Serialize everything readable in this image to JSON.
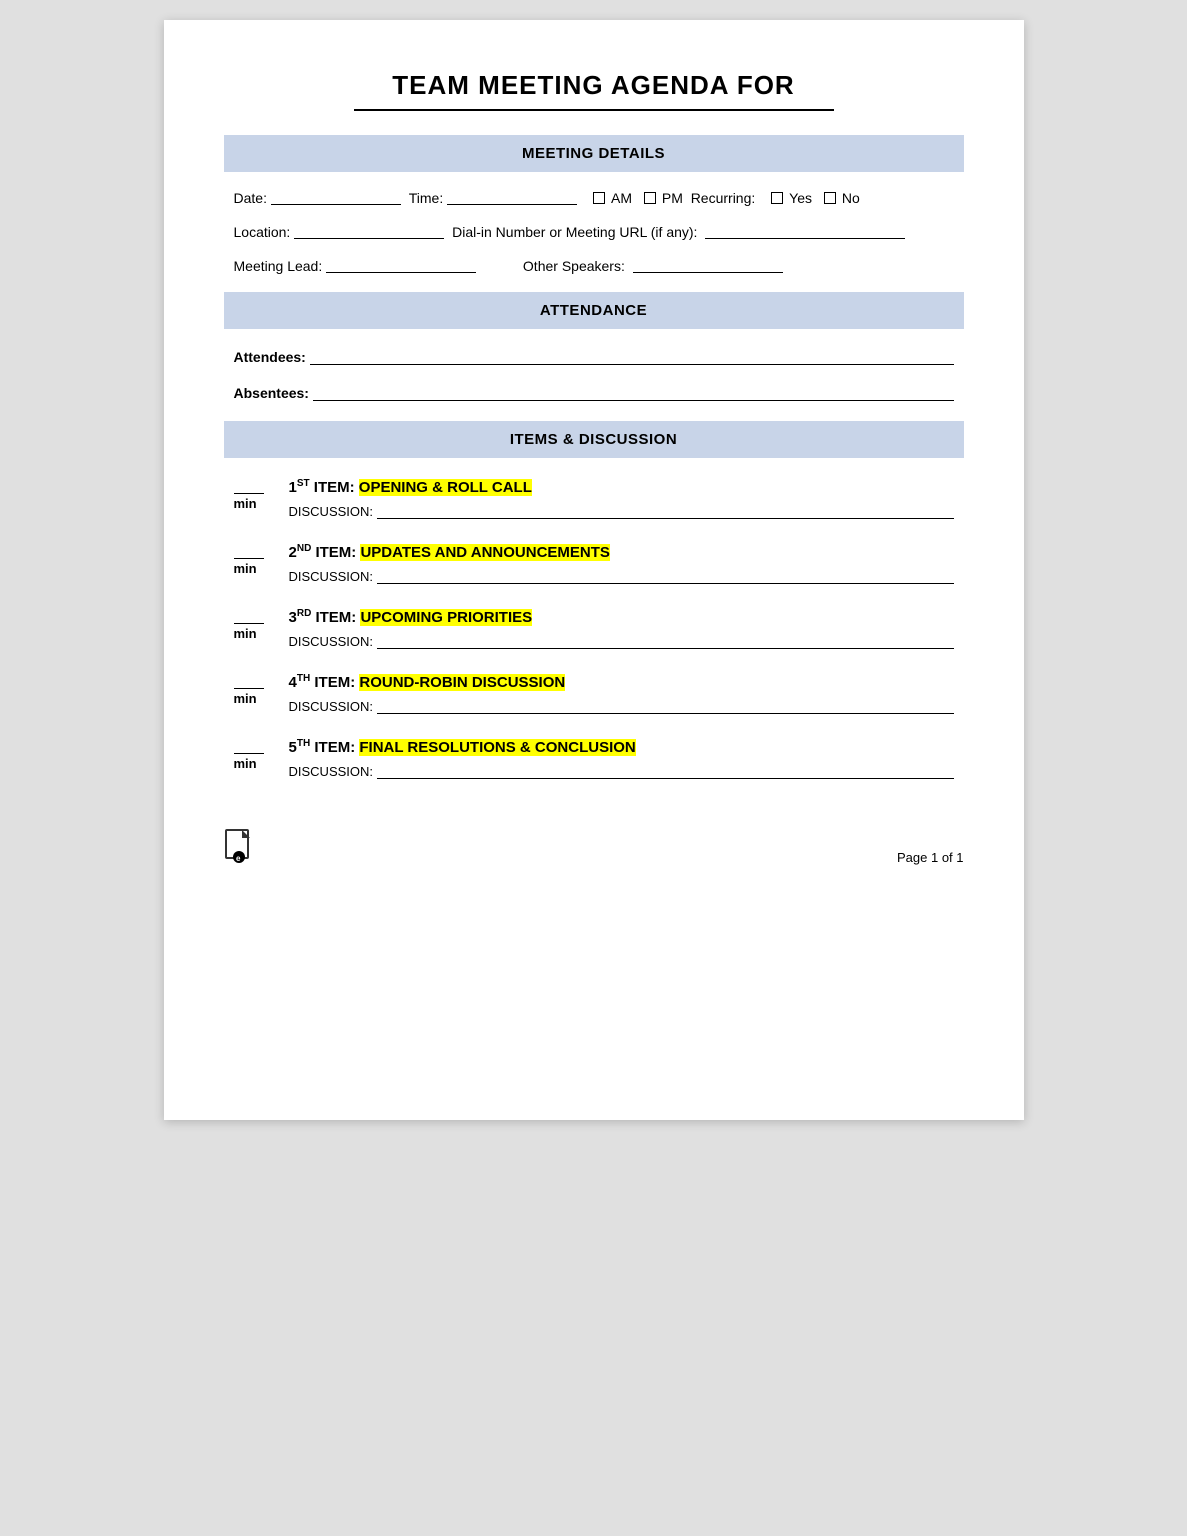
{
  "title": "TEAM MEETING AGENDA FOR",
  "sections": {
    "meeting_details": {
      "header": "MEETING DETAILS",
      "fields": {
        "date_label": "Date:",
        "time_label": "Time:",
        "am_label": "AM",
        "pm_label": "PM",
        "recurring_label": "Recurring:",
        "yes_label": "Yes",
        "no_label": "No",
        "location_label": "Location:",
        "dialin_label": "Dial-in Number or Meeting URL (if any):",
        "meeting_lead_label": "Meeting Lead:",
        "other_speakers_label": "Other Speakers:"
      }
    },
    "attendance": {
      "header": "ATTENDANCE",
      "attendees_label": "Attendees:",
      "absentees_label": "Absentees:"
    },
    "items_discussion": {
      "header": "ITEMS & DISCUSSION",
      "items": [
        {
          "number": "1",
          "ordinal": "ST",
          "title_prefix": "ITEM: ",
          "title_highlight": "OPENING & ROLL CALL",
          "discussion_label": "DISCUSSION:"
        },
        {
          "number": "2",
          "ordinal": "ND",
          "title_prefix": "ITEM: ",
          "title_highlight": "UPDATES AND ANNOUNCEMENTS",
          "discussion_label": "DISCUSSION:"
        },
        {
          "number": "3",
          "ordinal": "RD",
          "title_prefix": "ITEM: ",
          "title_highlight": "UPCOMING PRIORITIES",
          "discussion_label": "DISCUSSION:"
        },
        {
          "number": "4",
          "ordinal": "TH",
          "title_prefix": "ITEM: ",
          "title_highlight": "ROUND-ROBIN DISCUSSION",
          "discussion_label": "DISCUSSION:"
        },
        {
          "number": "5",
          "ordinal": "TH",
          "title_prefix": "ITEM: ",
          "title_highlight": "FINAL RESOLUTIONS & CONCLUSION",
          "discussion_label": "DISCUSSION:"
        }
      ]
    }
  },
  "footer": {
    "page_label": "Page 1 of 1"
  },
  "min_label": "min"
}
